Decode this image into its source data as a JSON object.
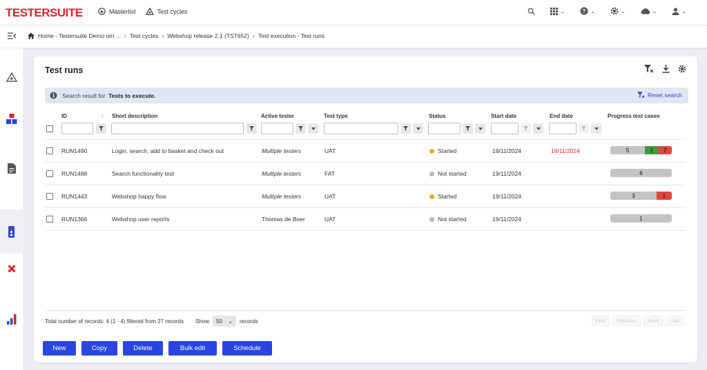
{
  "app": {
    "logo_text": "TESTERSUITE",
    "nav": [
      {
        "label": "Masterlist",
        "icon": "masterlist-icon"
      },
      {
        "label": "Test cycles",
        "icon": "test-cycles-icon"
      }
    ],
    "icons": [
      "search-icon",
      "apps-icon",
      "help-icon",
      "settings-icon",
      "cloud-icon",
      "user-icon"
    ]
  },
  "breadcrumb": {
    "items": [
      "Home - Testersuite Demo om ...",
      "Test cycles",
      "Webshop release 2.1 (TST652)",
      "Test execution - Test runs"
    ]
  },
  "sidebar": {
    "items": [
      "test-cycles-icon",
      "modules-icon",
      "document-icon",
      "traffic-light-icon",
      "defects-icon",
      "reports-icon"
    ]
  },
  "page": {
    "title": "Test runs",
    "info_prefix": "Search result for: ",
    "info_query": "Tests to execute.",
    "reset_label": "Reset search"
  },
  "table": {
    "columns": [
      "ID",
      "Short description",
      "Active tester",
      "Test type",
      "Status",
      "Start date",
      "End date",
      "Progress test cases"
    ],
    "rows": [
      {
        "id": "RUN1490",
        "desc": "Login, search, add to basket and check out",
        "tester": "Multiple testers",
        "tester_italic": true,
        "type": "UAT",
        "status": "Started",
        "status_color": "#f5a623",
        "start": "19/11/2024",
        "end": "19/11/2024",
        "progress": [
          {
            "value": "5",
            "color": "#c4c4c4",
            "frac": 0.56
          },
          {
            "value": "2",
            "color": "#3d9a40",
            "frac": 0.22
          },
          {
            "value": "2",
            "color": "#e0463f",
            "frac": 0.22
          }
        ]
      },
      {
        "id": "RUN1488",
        "desc": "Search functionality test",
        "tester": "Multiple testers",
        "tester_italic": true,
        "type": "FAT",
        "status": "Not started",
        "status_color": "#b8b8b8",
        "start": "19/11/2024",
        "end": "",
        "progress": [
          {
            "value": "6",
            "color": "#c4c4c4",
            "frac": 1
          }
        ]
      },
      {
        "id": "RUN1443",
        "desc": "Webshop happy flow",
        "tester": "Multiple testers",
        "tester_italic": true,
        "type": "UAT",
        "status": "Started",
        "status_color": "#f5a623",
        "start": "19/11/2024",
        "end": "",
        "progress": [
          {
            "value": "3",
            "color": "#c4c4c4",
            "frac": 0.75
          },
          {
            "value": "1",
            "color": "#e0463f",
            "frac": 0.25
          }
        ]
      },
      {
        "id": "RUN1366",
        "desc": "Webshop user reports",
        "tester": "Thomas de Boer",
        "tester_italic": false,
        "type": "UAT",
        "status": "Not started",
        "status_color": "#b8b8b8",
        "start": "19/11/2024",
        "end": "",
        "progress": [
          {
            "value": "1",
            "color": "#c4c4c4",
            "frac": 1
          }
        ]
      }
    ]
  },
  "footer": {
    "total_text": "Total number of records: 4 (1 - 4) filtered from 27 records",
    "show_label": "Show",
    "page_size": "50",
    "records_label": "records",
    "pager": [
      "First",
      "Previous",
      "Next",
      "Last"
    ]
  },
  "actions": [
    "New",
    "Copy",
    "Delete",
    "Bulk edit",
    "Schedule"
  ],
  "colors": {
    "accent": "#2a45e0",
    "brand": "#d7262b",
    "info_bg": "#e2e6f3"
  }
}
